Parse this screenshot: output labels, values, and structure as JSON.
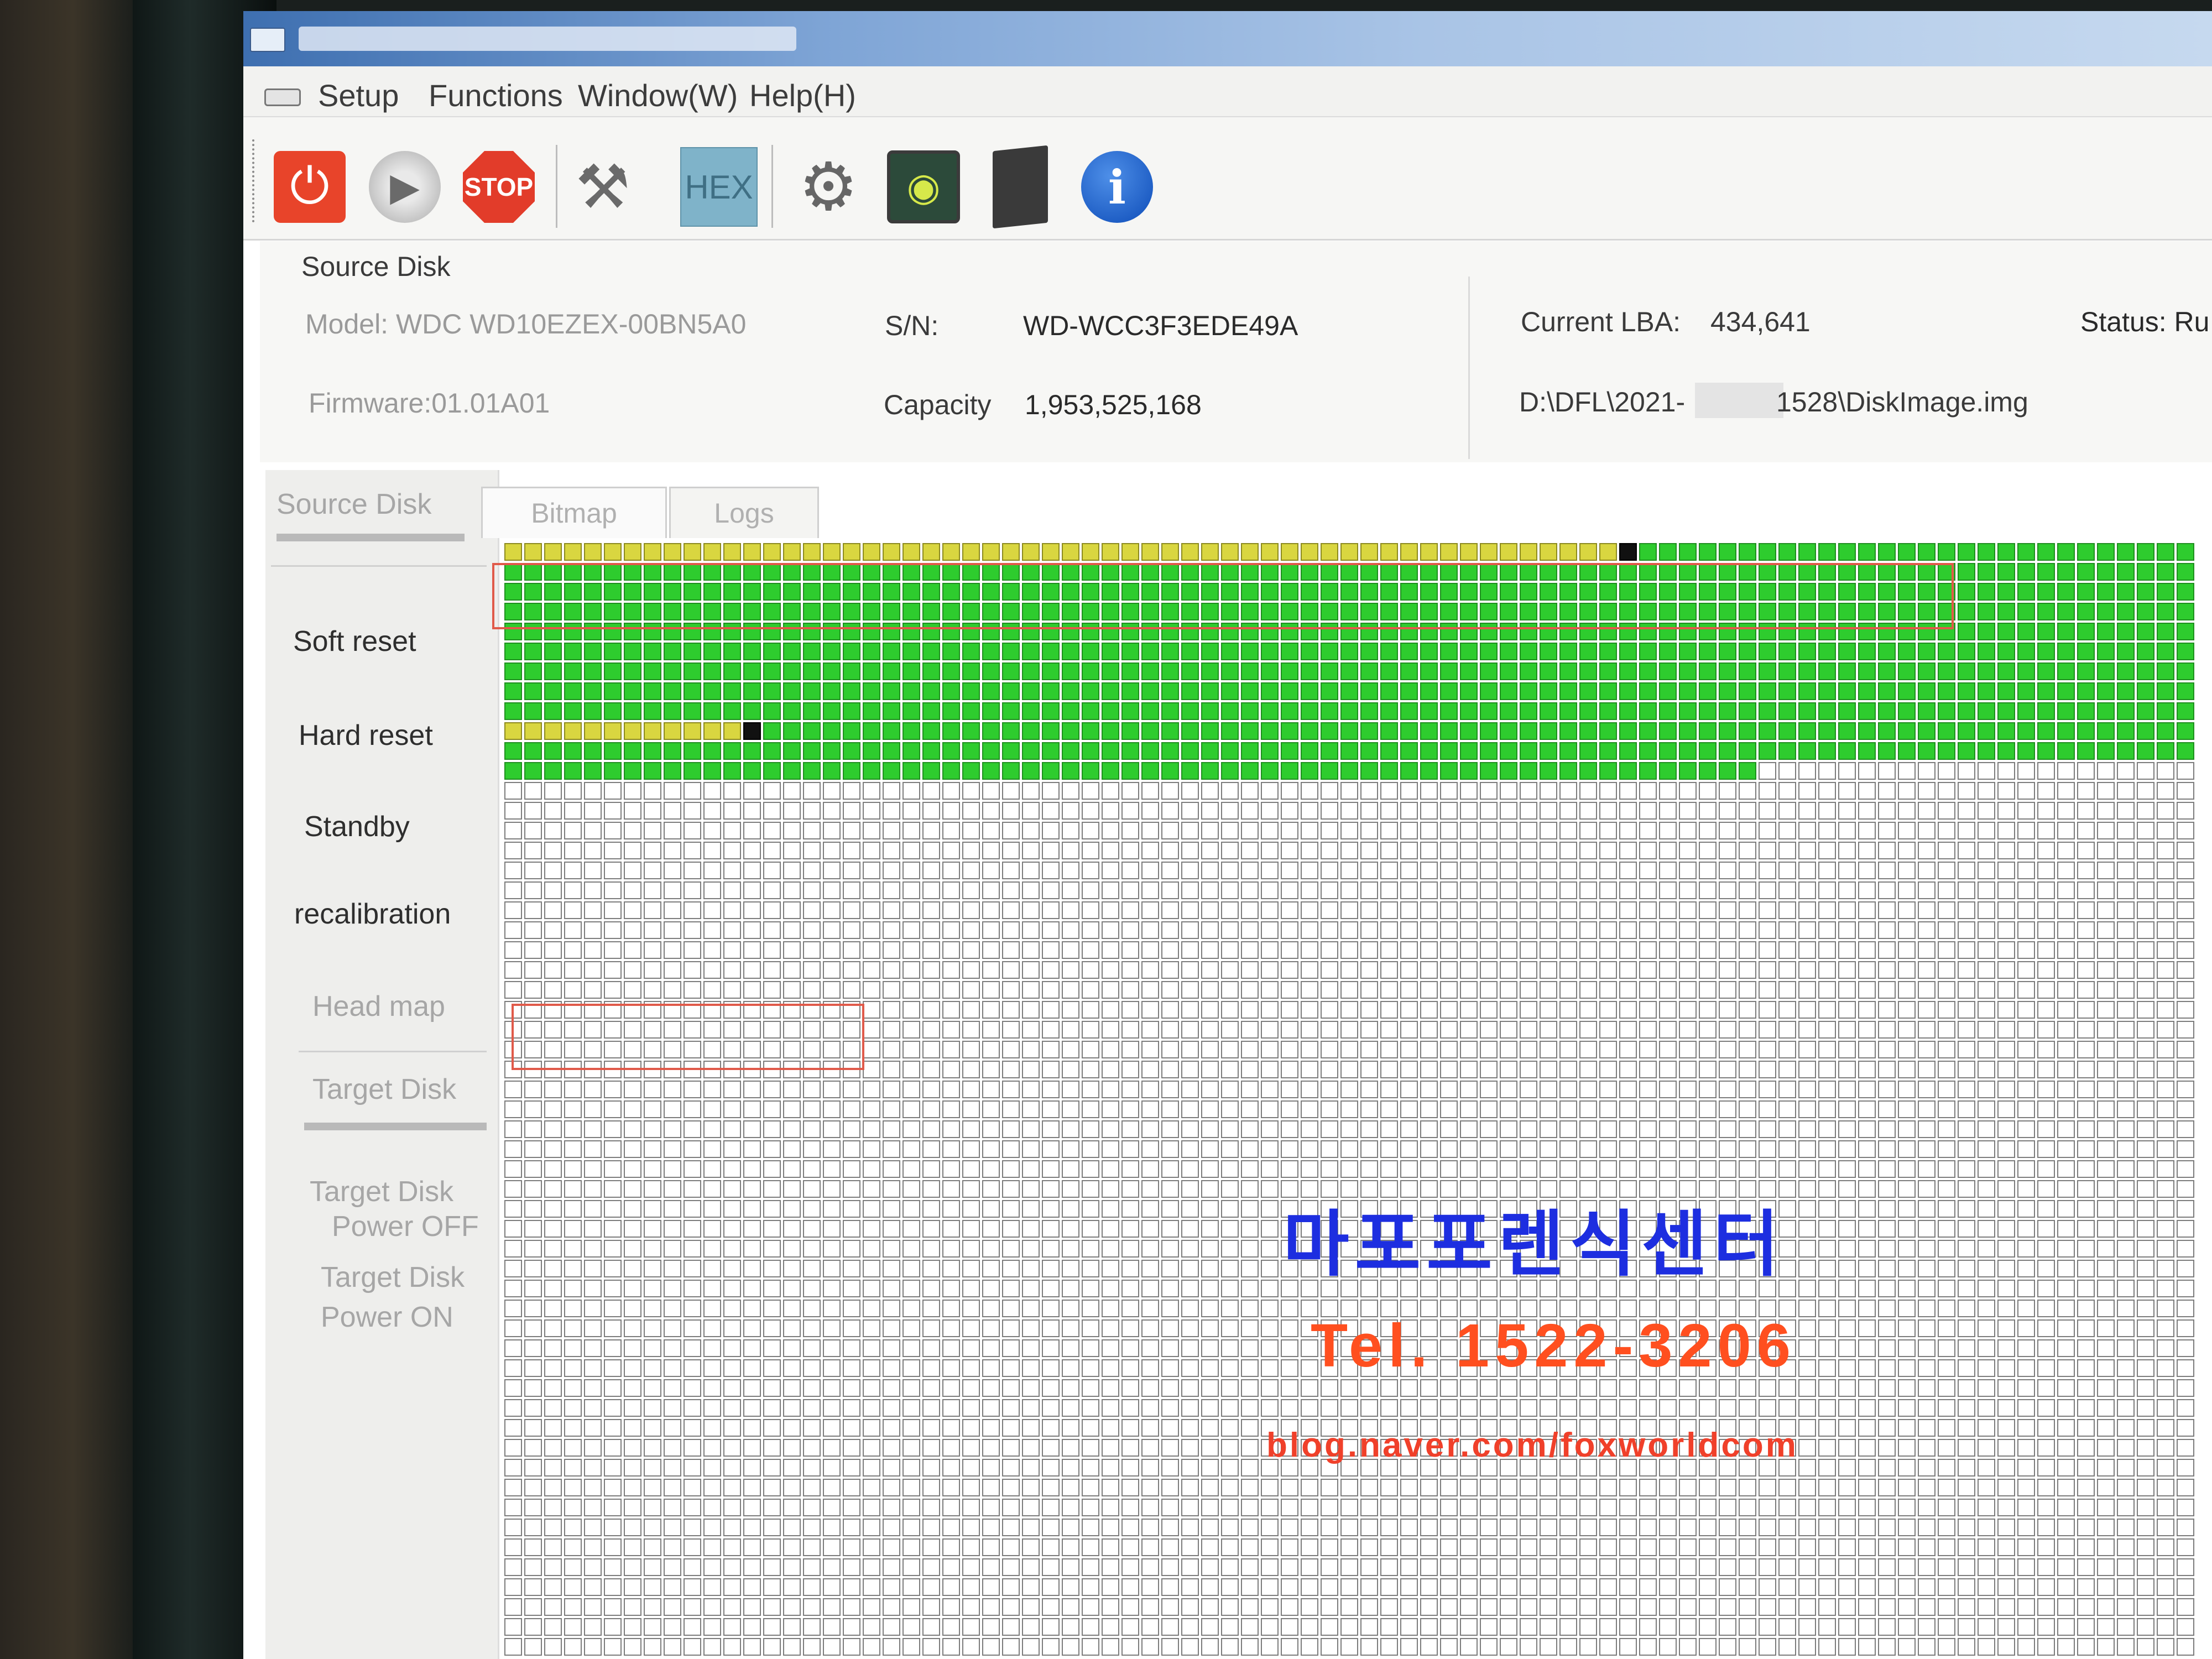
{
  "menu": {
    "setup": "Setup",
    "functions": "Functions",
    "window": "Window(W)",
    "help": "Help(H)"
  },
  "toolbar": {
    "buttons": [
      "power-icon",
      "play-icon",
      "stop-icon",
      "tools-icon",
      "hex-icon",
      "gear-icon",
      "image-icon",
      "book-icon",
      "info-icon"
    ],
    "stop_label": "STOP",
    "hex_label": "HEX"
  },
  "source_disk": {
    "heading": "Source Disk",
    "model": "Model: WDC WD10EZEX-00BN5A0",
    "firmware": "Firmware:01.01A01",
    "sn_label": "S/N:",
    "sn_value": "WD-WCC3F3EDE49A",
    "capacity_label": "Capacity",
    "capacity_value": "1,953,525,168",
    "current_lba_label": "Current LBA:",
    "current_lba_value": "434,641",
    "status_label": "Status: Ru",
    "image_path_start": "D:\\DFL\\2021-",
    "image_path_end": "1528\\DiskImage.img"
  },
  "sidebar": {
    "source_disk": "Source Disk",
    "soft_reset": "Soft reset",
    "hard_reset": "Hard reset",
    "standby": "Standby",
    "recalibration": "recalibration",
    "head_map": "Head map",
    "target_disk": "Target Disk",
    "target_power_off_1": "Target Disk",
    "target_power_off_2": "Power OFF",
    "target_power_on_1": "Target Disk",
    "target_power_on_2": "Power ON"
  },
  "tabs": {
    "bitmap": "Bitmap",
    "logs": "Logs"
  },
  "bitmap_map": {
    "colors": {
      "done": "#2ecc2e",
      "skipped": "#d9d640",
      "bad": "#111111",
      "pending": "#ffffff"
    }
  },
  "watermark": {
    "name": "마포포렌식센터",
    "tel": "Tel. 1522-3206",
    "blog": "blog.naver.com/foxworldcom"
  }
}
